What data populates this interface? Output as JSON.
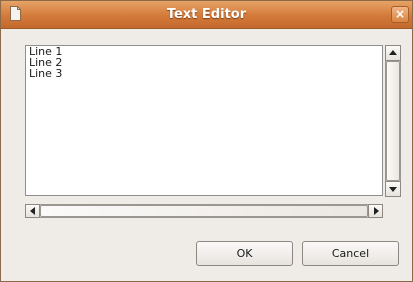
{
  "window": {
    "title": "Text Editor",
    "close_label": "×"
  },
  "editor": {
    "content": "Line 1\nLine 2\nLine 3"
  },
  "buttons": {
    "ok_label": "OK",
    "cancel_label": "Cancel"
  },
  "colors": {
    "titlebar": "#d37a3a",
    "window_bg": "#efebe7",
    "text_area_bg": "#ffffff"
  }
}
